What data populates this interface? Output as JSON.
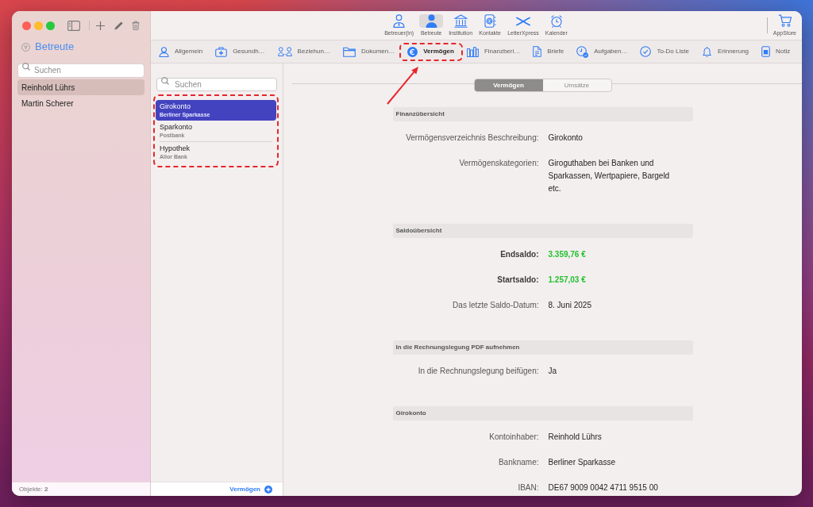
{
  "sidebar": {
    "title": "Betreute",
    "search": {
      "placeholder": "Suchen"
    },
    "items": [
      {
        "label": "Reinhold Lührs",
        "selected": true
      },
      {
        "label": "Martin Scherer",
        "selected": false
      }
    ],
    "footer": "Objekte: **2**"
  },
  "toolbar": {
    "items": [
      {
        "label": "Betreuer(in)",
        "selected": false
      },
      {
        "label": "Betreute",
        "selected": true
      },
      {
        "label": "Institution",
        "selected": false
      },
      {
        "label": "Kontakte",
        "selected": false
      },
      {
        "label": "LetterXpress",
        "selected": false
      },
      {
        "label": "Kalender",
        "selected": false
      }
    ],
    "store": "AppStore"
  },
  "tabs": [
    {
      "label": "Allgemein",
      "selected": false,
      "highlighted": false
    },
    {
      "label": "Gesundh…",
      "selected": false,
      "highlighted": false
    },
    {
      "label": "Beziehun…",
      "selected": false,
      "highlighted": false
    },
    {
      "label": "Dokumen…",
      "selected": false,
      "highlighted": false
    },
    {
      "label": "Vermögen",
      "selected": true,
      "highlighted": true
    },
    {
      "label": "Finanzberi…",
      "selected": false,
      "highlighted": false
    },
    {
      "label": "Briefe",
      "selected": false,
      "highlighted": false
    },
    {
      "label": "Aufgaben…",
      "selected": false,
      "highlighted": false
    },
    {
      "label": "To-Do Liste",
      "selected": false,
      "highlighted": false
    },
    {
      "label": "Erinnerung",
      "selected": false,
      "highlighted": false
    },
    {
      "label": "Notiz",
      "selected": false,
      "highlighted": false
    }
  ],
  "accounts": {
    "search": {
      "placeholder": "Suchen"
    },
    "highlighted": true,
    "items": [
      {
        "title": "Girokonto",
        "subtitle": "Berliner Sparkasse",
        "selected": true
      },
      {
        "title": "Sparkonto",
        "subtitle": "Postbank",
        "selected": false
      },
      {
        "title": "Hypothek",
        "subtitle": "Alior Bank",
        "selected": false
      }
    ],
    "add_button": "Vermögen"
  },
  "segments": [
    {
      "label": "Vermögen",
      "selected": true
    },
    {
      "label": "Umsätze",
      "selected": false
    }
  ],
  "sections": [
    {
      "title": "Finanzübersicht",
      "rows": [
        {
          "kind": "text",
          "label": "Vermögensverzeichnis Beschreibung:",
          "value": "Girokonto"
        },
        {
          "kind": "text",
          "label": "Vermögenskategorien:",
          "value": "Giroguthaben bei Banken und Sparkassen, Wertpapiere, Bargeld etc."
        }
      ]
    },
    {
      "title": "Saldoübersicht",
      "rows": [
        {
          "kind": "amount",
          "label": "Endsaldo:",
          "value": "3.359,76 €"
        },
        {
          "kind": "amount",
          "label": "Startsaldo:",
          "value": "1.257,03 €"
        },
        {
          "kind": "text",
          "label": "Das letzte Saldo-Datum:",
          "value": "8. Juni 2025"
        }
      ]
    },
    {
      "title": "In die Rechnungslegung PDF aufnehmen",
      "rows": [
        {
          "kind": "text",
          "label": "In die Rechnungslegung beifügen:",
          "value": "Ja"
        }
      ]
    },
    {
      "title": "Girokonto",
      "rows": [
        {
          "kind": "text",
          "label": "Kontoinhaber:",
          "value": "Reinhold Lührs"
        },
        {
          "kind": "text",
          "label": "Bankname:",
          "value": "Berliner Sparkasse"
        },
        {
          "kind": "text",
          "label": "IBAN:",
          "value": "DE67 9009 0042 4711 9515 00"
        }
      ]
    }
  ]
}
